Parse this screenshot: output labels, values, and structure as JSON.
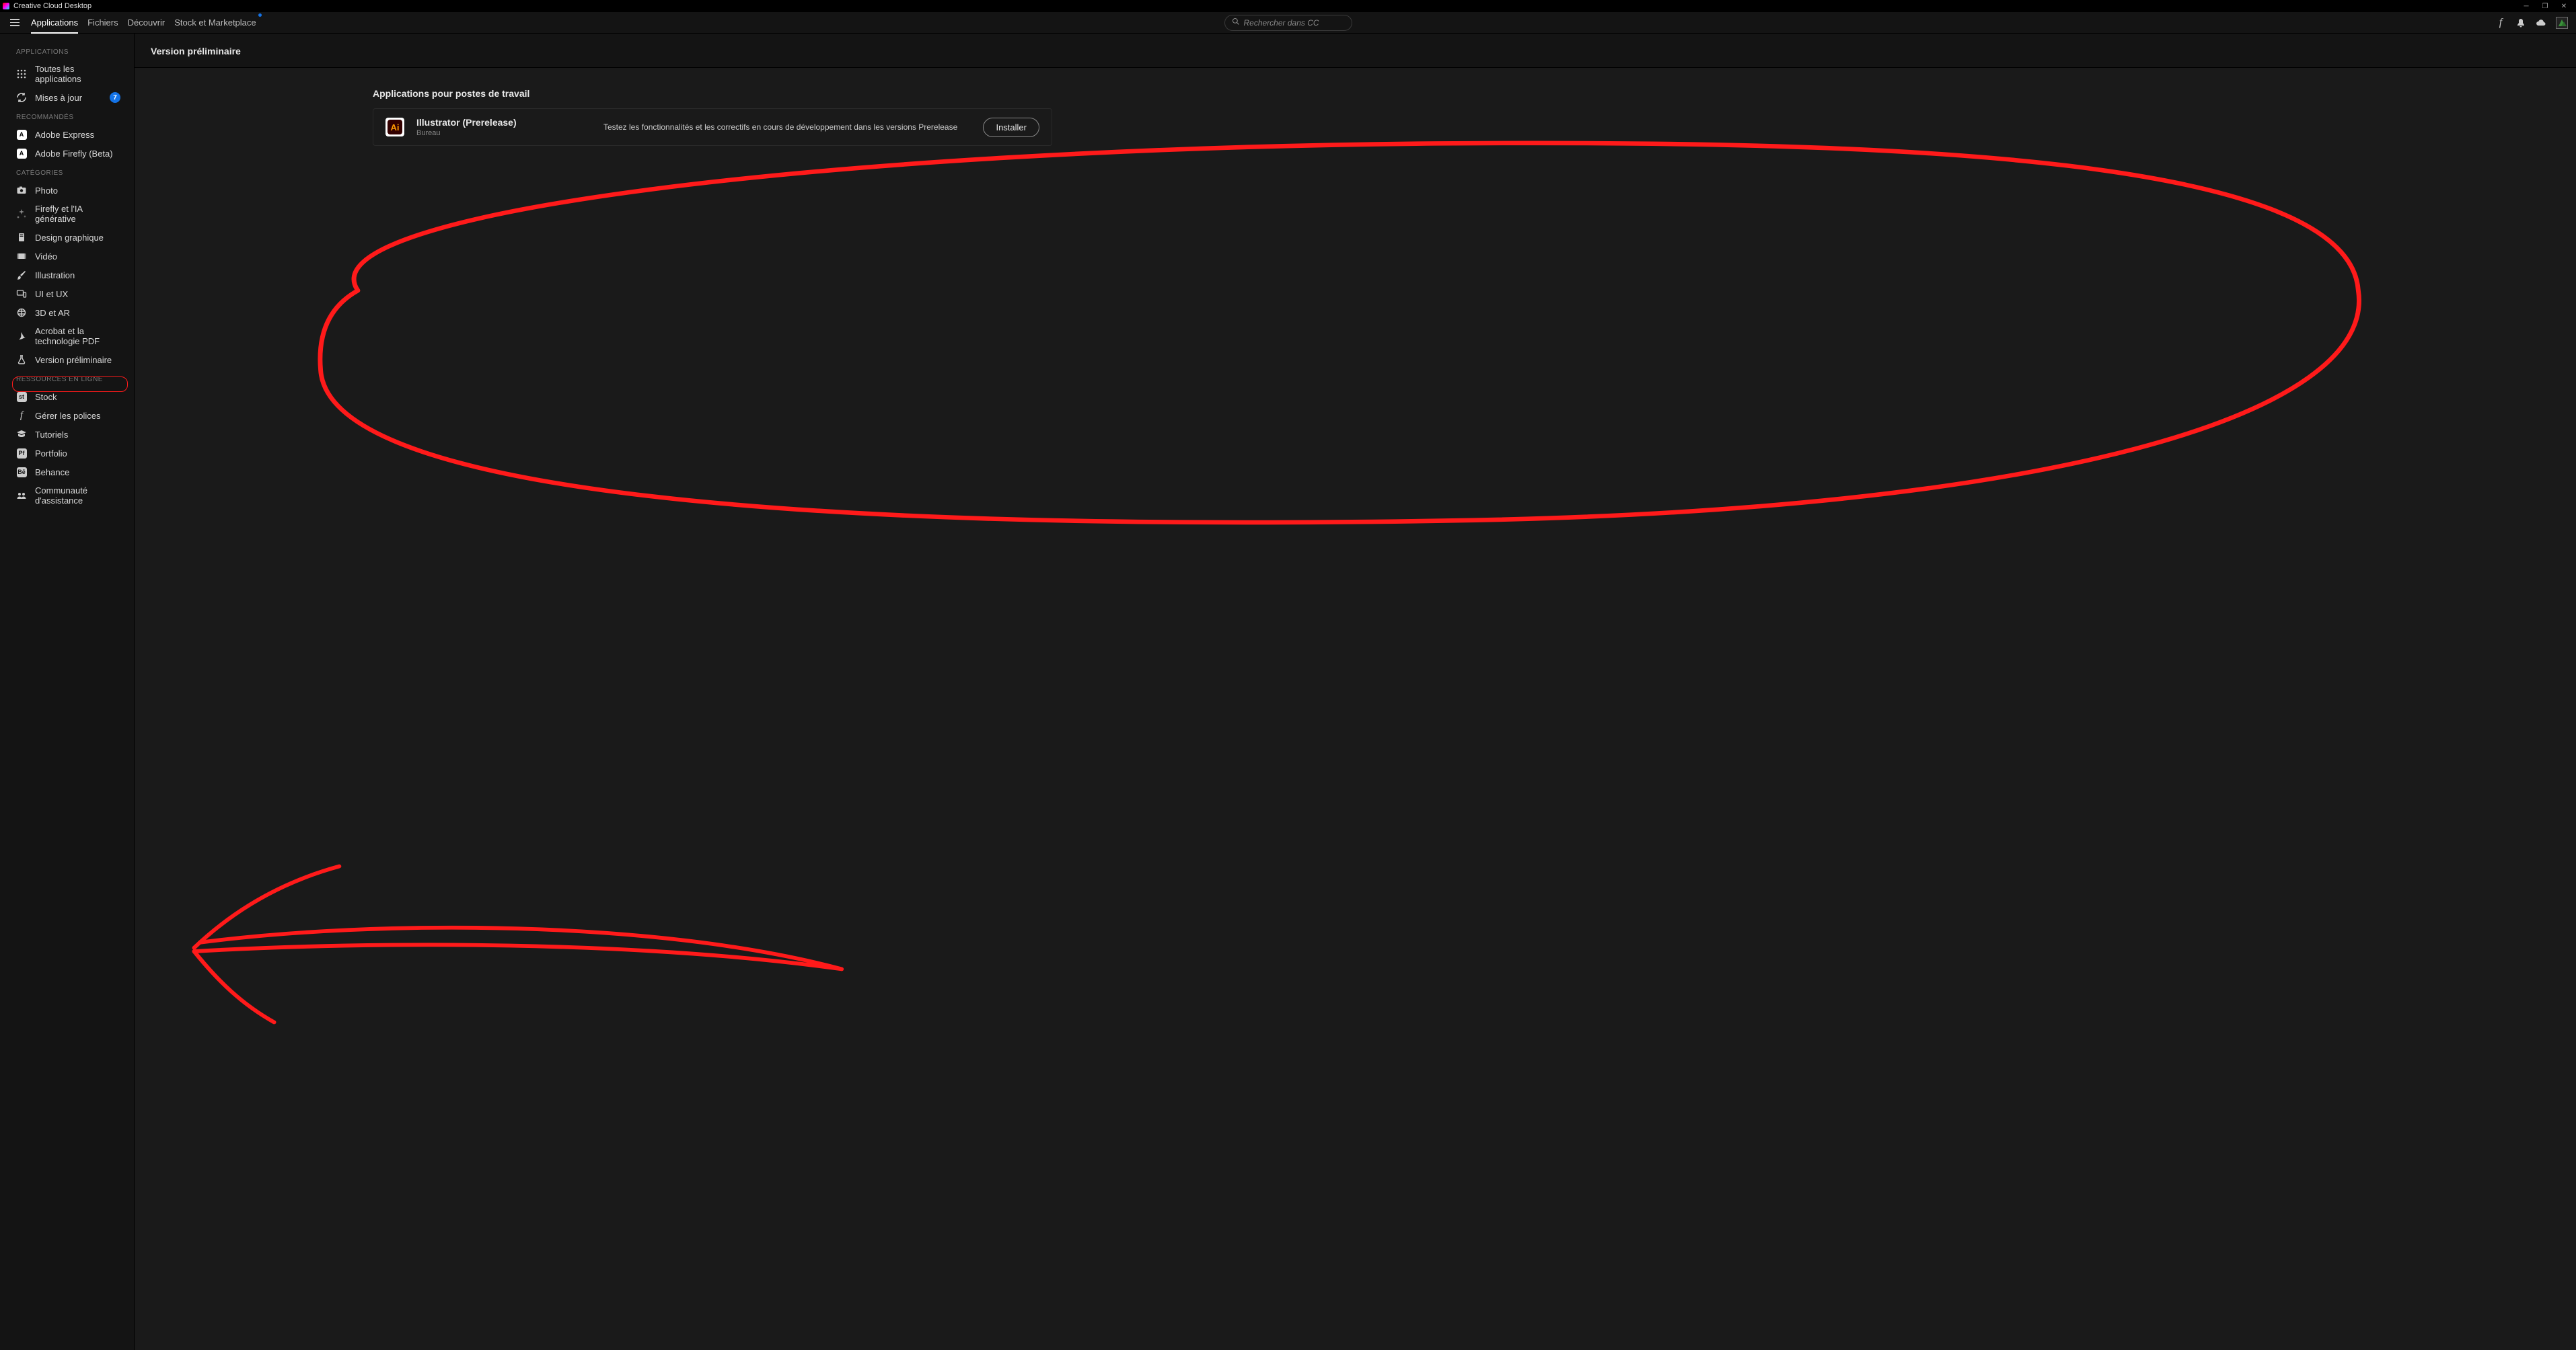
{
  "titlebar": {
    "title": "Creative Cloud Desktop"
  },
  "nav": {
    "tabs": [
      {
        "label": "Applications",
        "active": true
      },
      {
        "label": "Fichiers"
      },
      {
        "label": "Découvrir"
      },
      {
        "label": "Stock et Marketplace",
        "dot": true
      }
    ]
  },
  "search": {
    "placeholder": "Rechercher dans CC"
  },
  "sidebar": {
    "sections": [
      {
        "header": "APPLICATIONS",
        "items": [
          {
            "icon": "grid",
            "label": "Toutes les applications"
          },
          {
            "icon": "refresh",
            "label": "Mises à jour",
            "badge": "7"
          }
        ]
      },
      {
        "header": "RECOMMANDÉS",
        "items": [
          {
            "icon": "express",
            "label": "Adobe Express"
          },
          {
            "icon": "firefly",
            "label": "Adobe Firefly (Beta)"
          }
        ]
      },
      {
        "header": "CATÉGORIES",
        "items": [
          {
            "icon": "camera",
            "label": "Photo"
          },
          {
            "icon": "sparkle",
            "label": "Firefly et l'IA générative"
          },
          {
            "icon": "palette",
            "label": "Design graphique"
          },
          {
            "icon": "video",
            "label": "Vidéo"
          },
          {
            "icon": "brush",
            "label": "Illustration"
          },
          {
            "icon": "devices",
            "label": "UI et UX"
          },
          {
            "icon": "globe3d",
            "label": "3D et AR"
          },
          {
            "icon": "acrobat",
            "label": "Acrobat et la technologie PDF"
          },
          {
            "icon": "flask",
            "label": "Version préliminaire",
            "active": true
          }
        ]
      },
      {
        "header": "RESSOURCES EN LIGNE",
        "items": [
          {
            "icon": "stock",
            "label": "Stock"
          },
          {
            "icon": "font",
            "label": "Gérer les polices"
          },
          {
            "icon": "grad",
            "label": "Tutoriels"
          },
          {
            "icon": "portfolio",
            "label": "Portfolio"
          },
          {
            "icon": "behance",
            "label": "Behance"
          },
          {
            "icon": "community",
            "label": "Communauté d'assistance"
          }
        ]
      }
    ]
  },
  "page": {
    "title": "Version préliminaire",
    "section_title": "Applications pour postes de travail",
    "apps": [
      {
        "icon_label": "Ai",
        "name": "Illustrator (Prerelease)",
        "subtype": "Bureau",
        "description": "Testez les fonctionnalités et les correctifs en cours de développement dans les versions Prerelease",
        "button": "Installer"
      }
    ]
  },
  "colors": {
    "accent_blue": "#1473e6",
    "annotation_red": "#ff2222"
  }
}
